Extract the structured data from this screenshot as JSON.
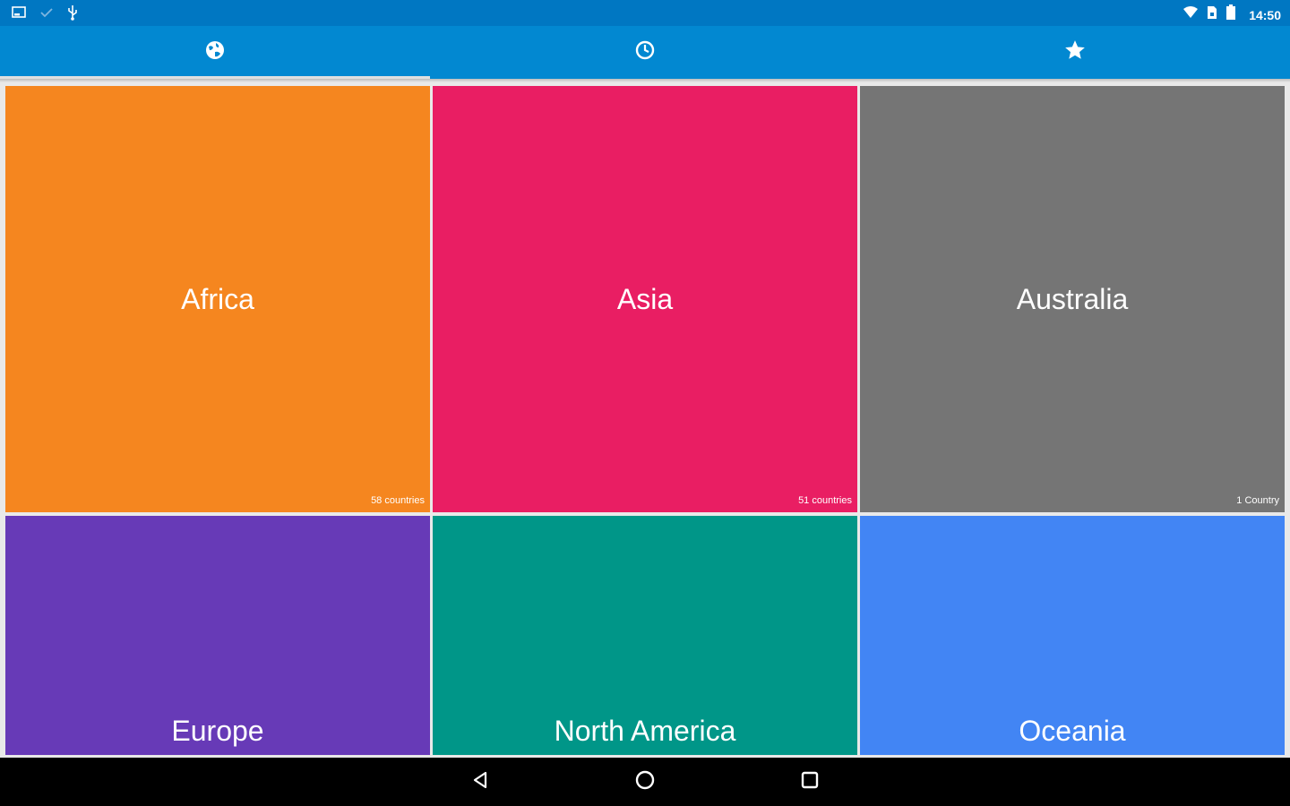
{
  "status_bar": {
    "time": "14:50",
    "left_icons": [
      "screenshot-icon",
      "check-icon",
      "usb-icon"
    ],
    "right_icons": [
      "wifi-icon",
      "sim-icon",
      "battery-icon"
    ]
  },
  "tabs": [
    {
      "icon": "globe-icon",
      "active": true
    },
    {
      "icon": "clock-icon",
      "active": false
    },
    {
      "icon": "star-icon",
      "active": false
    }
  ],
  "colors": {
    "status_bar": "#0077c2",
    "tab_bar": "#0288d1"
  },
  "continents": [
    {
      "name": "Africa",
      "count": "58 countries",
      "color": "#f5861f"
    },
    {
      "name": "Asia",
      "count": "51 countries",
      "color": "#e91e63"
    },
    {
      "name": "Australia",
      "count": "1 Country",
      "color": "#757575"
    },
    {
      "name": "Europe",
      "count": "",
      "color": "#673ab7"
    },
    {
      "name": "North America",
      "count": "",
      "color": "#009688"
    },
    {
      "name": "Oceania",
      "count": "",
      "color": "#4285f4"
    }
  ],
  "nav_bar": [
    "back-icon",
    "home-icon",
    "recents-icon"
  ]
}
